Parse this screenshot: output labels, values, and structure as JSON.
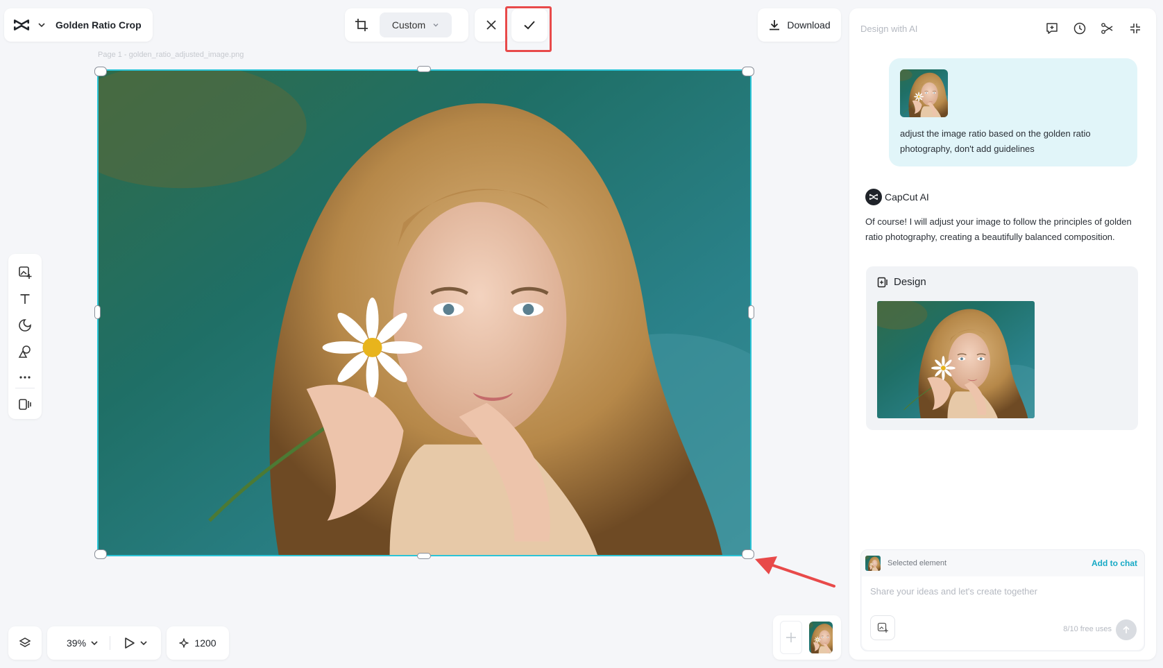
{
  "header": {
    "project_title": "Golden Ratio Crop",
    "crop_ratio": "Custom",
    "download_label": "Download"
  },
  "canvas": {
    "page_label": "Page 1 -  golden_ratio_adjusted_image.png"
  },
  "bottom_bar": {
    "zoom": "39%",
    "credits": "1200"
  },
  "ai_panel": {
    "header_placeholder": "Design with AI",
    "user_message": "adjust the image ratio based on the golden ratio photography, don't add guidelines",
    "ai_name": "CapCut AI",
    "ai_reply": "Of course! I will adjust your image to follow the principles of golden ratio photography, creating a beautifully balanced composition.",
    "design_card_title": "Design",
    "selected_element_label": "Selected element",
    "add_to_chat_label": "Add to chat",
    "input_placeholder": "Share your ideas and let's create together",
    "free_uses": "8/10 free uses"
  },
  "colors": {
    "selection_border": "#2bc4d6",
    "highlight_red": "#e84a4a",
    "user_bubble": "#e1f5f9",
    "accent_teal": "#16a9c5"
  }
}
